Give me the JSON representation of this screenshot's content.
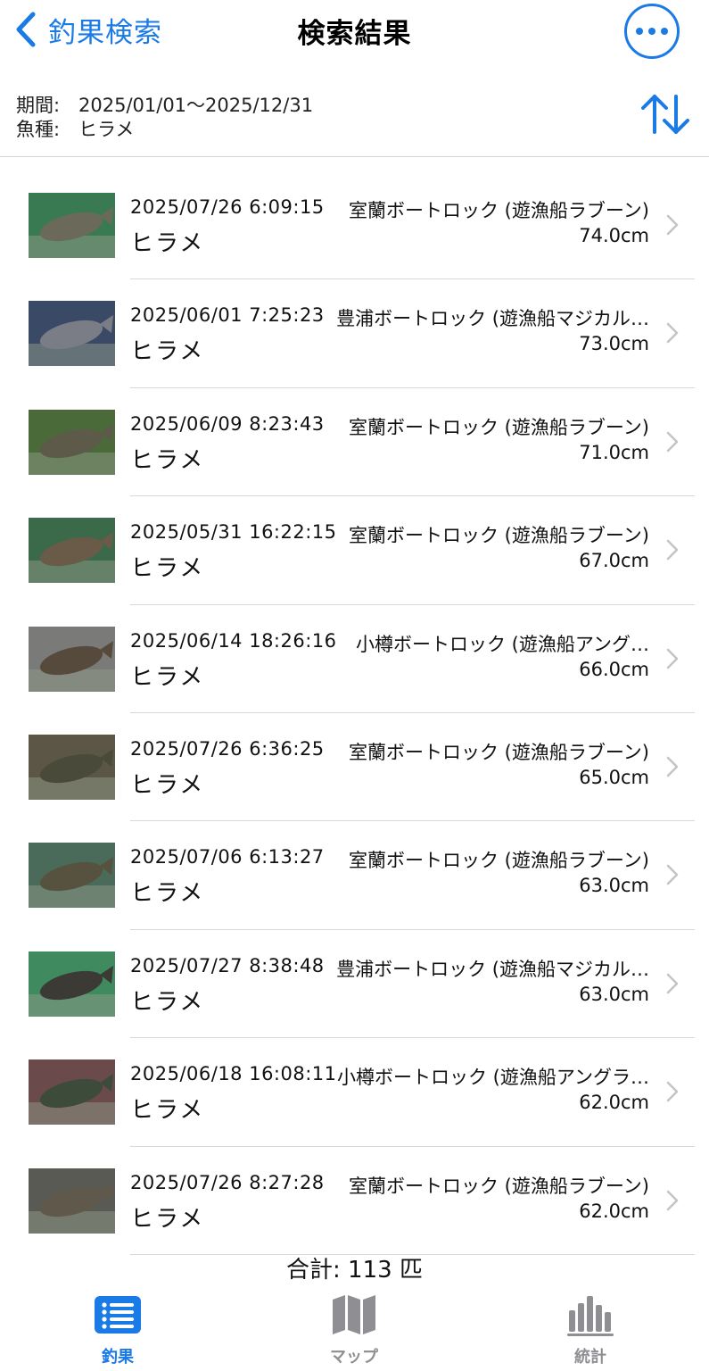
{
  "nav": {
    "back_label": "釣果検索",
    "title": "検索結果"
  },
  "filters": {
    "period_label": "期間:",
    "period_value": "2025/01/01～2025/12/31",
    "species_label": "魚種:",
    "species_value": "ヒラメ"
  },
  "results": [
    {
      "datetime": "2025/07/26 6:09:15",
      "location": "室蘭ボートロック (遊漁船ラブーン)",
      "fish": "ヒラメ",
      "size": "74.0cm"
    },
    {
      "datetime": "2025/06/01 7:25:23",
      "location": "豊浦ボートロック (遊漁船マジカル…",
      "fish": "ヒラメ",
      "size": "73.0cm"
    },
    {
      "datetime": "2025/06/09 8:23:43",
      "location": "室蘭ボートロック (遊漁船ラブーン)",
      "fish": "ヒラメ",
      "size": "71.0cm"
    },
    {
      "datetime": "2025/05/31 16:22:15",
      "location": "室蘭ボートロック (遊漁船ラブーン)",
      "fish": "ヒラメ",
      "size": "67.0cm"
    },
    {
      "datetime": "2025/06/14 18:26:16",
      "location": "小樽ボートロック (遊漁船アング…",
      "fish": "ヒラメ",
      "size": "66.0cm"
    },
    {
      "datetime": "2025/07/26 6:36:25",
      "location": "室蘭ボートロック (遊漁船ラブーン)",
      "fish": "ヒラメ",
      "size": "65.0cm"
    },
    {
      "datetime": "2025/07/06 6:13:27",
      "location": "室蘭ボートロック (遊漁船ラブーン)",
      "fish": "ヒラメ",
      "size": "63.0cm"
    },
    {
      "datetime": "2025/07/27 8:38:48",
      "location": "豊浦ボートロック (遊漁船マジカル…",
      "fish": "ヒラメ",
      "size": "63.0cm"
    },
    {
      "datetime": "2025/06/18 16:08:11",
      "location": "小樽ボートロック (遊漁船アングラ…",
      "fish": "ヒラメ",
      "size": "62.0cm"
    },
    {
      "datetime": "2025/07/26 8:27:28",
      "location": "室蘭ボートロック (遊漁船ラブーン)",
      "fish": "ヒラメ",
      "size": "62.0cm"
    }
  ],
  "total": "合計: 113 匹",
  "tabs": [
    {
      "label": "釣果",
      "icon": "list-icon",
      "active": true
    },
    {
      "label": "マップ",
      "icon": "map-icon",
      "active": false
    },
    {
      "label": "統計",
      "icon": "bar-chart-icon",
      "active": false
    }
  ],
  "colors": {
    "accent": "#1a7ae6",
    "inactive": "#8e8e93",
    "divider": "#d8d8da"
  }
}
